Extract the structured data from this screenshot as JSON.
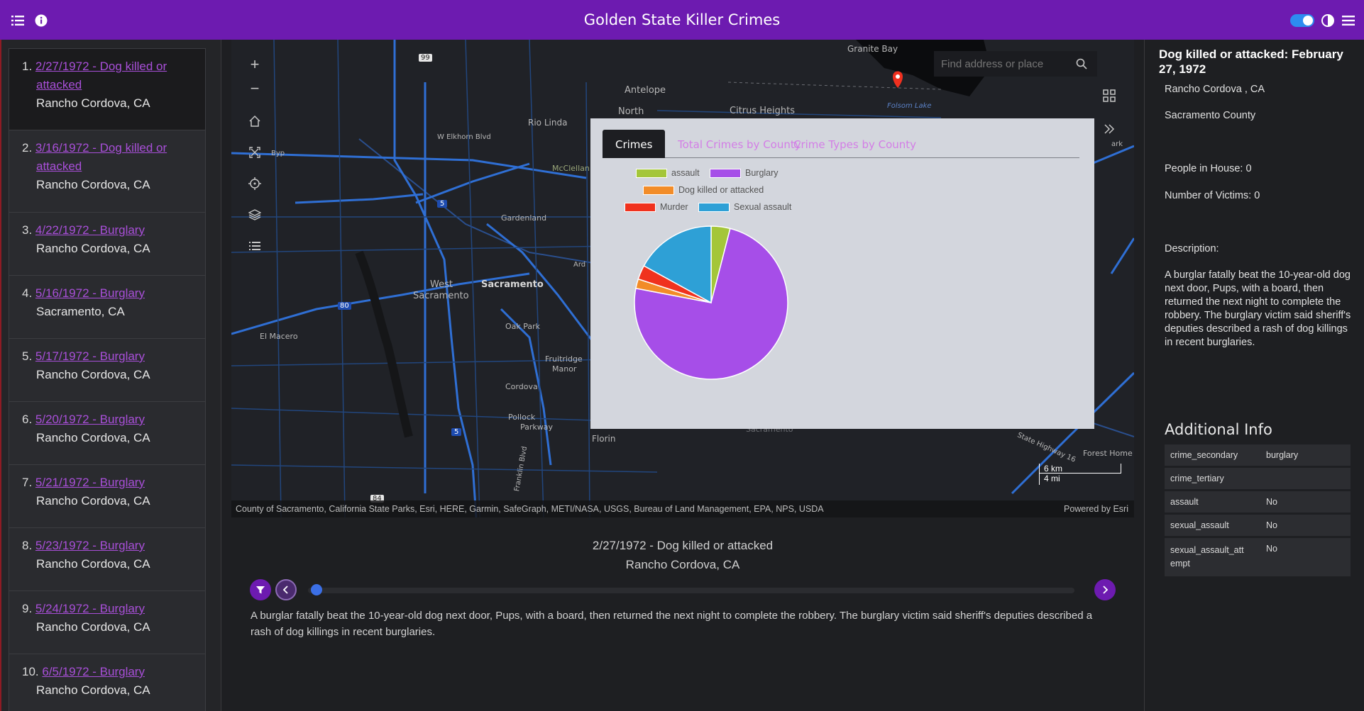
{
  "app": {
    "title": "Golden State Killer Crimes",
    "accent": "#6d1bb0"
  },
  "header_icons": [
    "list-icon",
    "info-icon",
    "theme-toggle",
    "contrast-icon",
    "menu-icon"
  ],
  "crime_list": [
    {
      "num": "1.",
      "title": "2/27/1972 - Dog killed or attacked",
      "line1": "2/27/1972 - Dog killed or",
      "line2": "attacked",
      "location": "Rancho Cordova, CA"
    },
    {
      "num": "2.",
      "title": "3/16/1972 - Dog killed or attacked",
      "line1": "3/16/1972 - Dog killed or",
      "line2": "attacked",
      "location": "Rancho Cordova, CA"
    },
    {
      "num": "3.",
      "title": "4/22/1972 - Burglary",
      "location": "Rancho Cordova, CA"
    },
    {
      "num": "4.",
      "title": "5/16/1972 - Burglary",
      "location": "Sacramento, CA"
    },
    {
      "num": "5.",
      "title": "5/17/1972 - Burglary",
      "location": "Rancho Cordova, CA"
    },
    {
      "num": "6.",
      "title": "5/20/1972 - Burglary",
      "location": "Rancho Cordova, CA"
    },
    {
      "num": "7.",
      "title": "5/21/1972 - Burglary",
      "location": "Rancho Cordova, CA"
    },
    {
      "num": "8.",
      "title": "5/23/1972 - Burglary",
      "location": "Rancho Cordova, CA"
    },
    {
      "num": "9.",
      "title": "5/24/1972 - Burglary",
      "location": "Rancho Cordova, CA"
    },
    {
      "num": "10.",
      "title": "6/5/1972 - Burglary",
      "location": "Rancho Cordova, CA"
    }
  ],
  "map": {
    "search_placeholder": "Find address or place",
    "attribution": "County of Sacramento, California State Parks, Esri, HERE, Garmin, SafeGraph, METI/NASA, USGS, Bureau of Land Management, EPA, NPS, USDA",
    "powered_by": "Powered by Esri",
    "scale_km": "6 km",
    "scale_mi": "4 mi",
    "labels": {
      "granite_bay": "Granite Bay",
      "antelope": "Antelope",
      "north": "North",
      "citrus_heights": "Citrus Heights",
      "rio_linda": "Rio Linda",
      "elkhorn": "W Elkhorn Blvd",
      "byp": "Byp",
      "mcclellan": "McClellan",
      "gardenland": "Gardenland",
      "west_sacramento_1": "West",
      "west_sacramento_2": "Sacramento",
      "sacramento": "Sacramento",
      "el_macero": "El Macero",
      "oak_park": "Oak Park",
      "fruitridge_1": "Fruitridge",
      "fruitridge_2": "Manor",
      "cordova": "Cordova",
      "pollock_1": "Pollock",
      "pollock_2": "Parkway",
      "florin": "Florin",
      "franklin": "Franklin Blvd",
      "folsom_lake": "Folsom Lake",
      "forest_home": "Forest Home",
      "state_hwy": "State Highway 16",
      "ard": "Ard",
      "ark": "ark",
      "sacramento_county_partial": "Sacramento",
      "shield_99": "99",
      "shield_80": "80",
      "shield_5a": "5",
      "shield_5b": "5",
      "shield_84": "84"
    }
  },
  "popup": {
    "tabs": [
      "Crimes",
      "Total Crimes by County",
      "Crime Types by County"
    ],
    "active_tab": "Crimes"
  },
  "chart_data": {
    "type": "pie",
    "categories": [
      "assault",
      "Burglary",
      "Dog killed or attacked",
      "Murder",
      "Sexual assault"
    ],
    "values": [
      4,
      74,
      2,
      3,
      17
    ],
    "colors": [
      "#a4c639",
      "#a64ee8",
      "#f28c28",
      "#f0321e",
      "#2ea0d6"
    ],
    "legend_position": "top-left"
  },
  "selected": {
    "title": "2/27/1972 - Dog killed or attacked",
    "location": "Rancho Cordova, CA",
    "description": "A burglar fatally beat the 10-year-old dog next door, Pups, with a board, then returned the next night to complete the robbery. The burglary victim said sheriff's deputies described a rash of dog killings in recent burglaries."
  },
  "detail": {
    "heading": "Dog killed or attacked: February 27, 1972",
    "city": "Rancho Cordova , CA",
    "county": "Sacramento County",
    "people_in_house": "People in House: 0",
    "victims": "Number of Victims: 0",
    "description_label": "Description:",
    "description": "A burglar fatally beat the 10-year-old dog next door, Pups, with a board, then returned the next night to complete the robbery. The burglary victim said sheriff's deputies described a rash of dog killings in recent burglaries.",
    "additional_info_label": "Additional Info",
    "additional_info": [
      {
        "key": "crime_secondary",
        "value": "burglary"
      },
      {
        "key": "crime_tertiary",
        "value": ""
      },
      {
        "key": "assault",
        "value": "No"
      },
      {
        "key": "sexual_assault",
        "value": "No"
      },
      {
        "key": "sexual_assault_att empt",
        "value": "No"
      }
    ]
  }
}
